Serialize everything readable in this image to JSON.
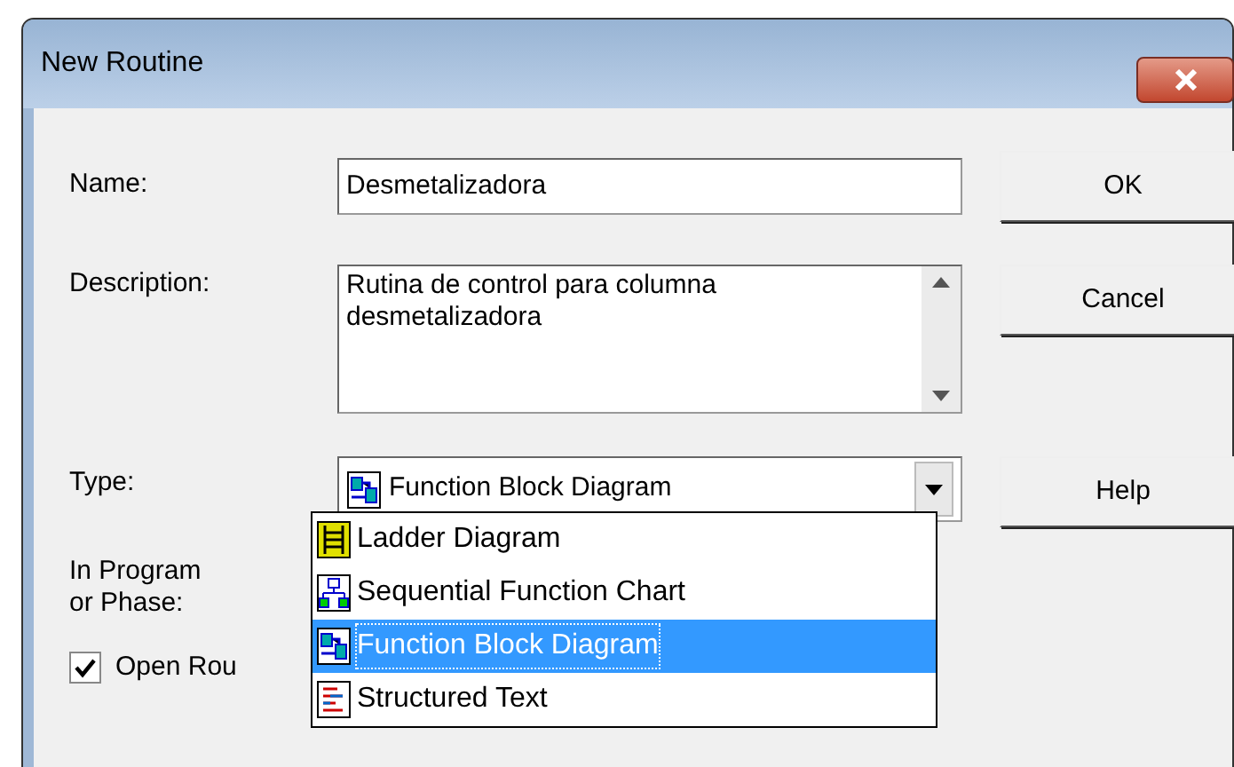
{
  "window": {
    "title": "New Routine"
  },
  "fields": {
    "name_label": "Name:",
    "name_value": "Desmetalizadora",
    "description_label": "Description:",
    "description_value": "Rutina de control para columna desmetalizadora",
    "type_label": "Type:",
    "type_value": "Function Block Diagram",
    "program_label": "In Program\nor Phase:"
  },
  "buttons": [
    "OK",
    "Cancel",
    "Help"
  ],
  "open_routine": {
    "label": "Open Rou",
    "checked": true
  },
  "type_options": [
    {
      "label": "Ladder Diagram",
      "kind": "ladder",
      "selected": false
    },
    {
      "label": "Sequential Function Chart",
      "kind": "sfc",
      "selected": false
    },
    {
      "label": "Function Block Diagram",
      "kind": "fbd",
      "selected": true
    },
    {
      "label": "Structured Text",
      "kind": "st",
      "selected": false
    }
  ]
}
